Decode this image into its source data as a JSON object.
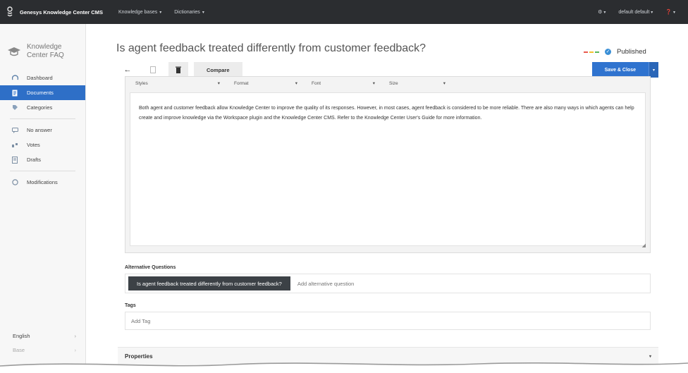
{
  "topbar": {
    "app_title": "Genesys Knowledge Center CMS",
    "menus": [
      "Knowledge bases",
      "Dictionaries"
    ],
    "user": "default default"
  },
  "sidebar": {
    "brand": "Knowledge\nCenter FAQ",
    "items": [
      {
        "label": "Dashboard",
        "icon": "dashboard-icon"
      },
      {
        "label": "Documents",
        "icon": "document-icon"
      },
      {
        "label": "Categories",
        "icon": "tag-icon"
      },
      {
        "label": "No answer",
        "icon": "no-answer-icon"
      },
      {
        "label": "Votes",
        "icon": "votes-icon"
      },
      {
        "label": "Drafts",
        "icon": "drafts-icon"
      },
      {
        "label": "Modifications",
        "icon": "modifications-icon"
      }
    ],
    "footer": {
      "language": "English",
      "secondary": "Base"
    }
  },
  "header": {
    "title": "Is agent feedback treated differently from customer feedback?",
    "status": "Published",
    "status_colors": [
      "#e85a4f",
      "#f2c230",
      "#58b85c"
    ]
  },
  "toolbar": {
    "compare": "Compare",
    "save_close": "Save & Close"
  },
  "editor": {
    "styles": "Styles",
    "format": "Format",
    "font": "Font",
    "size": "Size",
    "body": "Both agent and customer feedback allow Knowledge Center to improve the quality of its responses. However, in most cases, agent feedback is considered to be more reliable. There are also many ways in which agents can help create and improve knowledge via the Workspace plugin and the Knowledge Center CMS. Refer to the Knowledge Center User's Guide for more information."
  },
  "alternative_questions": {
    "label": "Alternative Questions",
    "chip": "Is agent feedback treated differently from customer feedback?",
    "placeholder": "Add alternative question"
  },
  "tags": {
    "label": "Tags",
    "placeholder": "Add Tag"
  },
  "properties": {
    "label": "Properties"
  },
  "colors": {
    "accent": "#2f73cf",
    "topbar": "#2b2d30"
  }
}
